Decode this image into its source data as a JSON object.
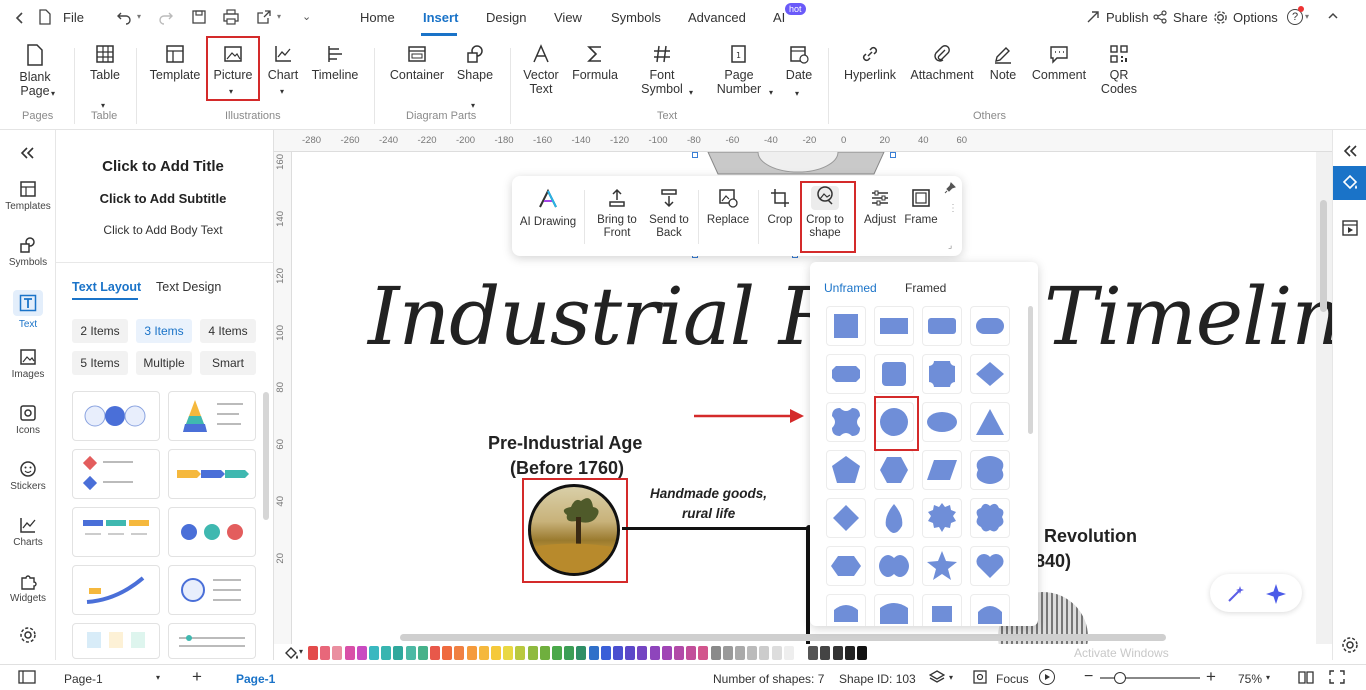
{
  "topbar": {
    "file_label": "File",
    "tabs": [
      "Home",
      "Insert",
      "Design",
      "View",
      "Symbols",
      "Advanced",
      "AI"
    ],
    "active_tab": "Insert",
    "ai_badge": "hot",
    "publish_label": "Publish",
    "share_label": "Share",
    "options_label": "Options"
  },
  "ribbon": {
    "blank_page": "Blank Page",
    "table": "Table",
    "template": "Template",
    "picture": "Picture",
    "chart": "Chart",
    "timeline": "Timeline",
    "container": "Container",
    "shape": "Shape",
    "vector_text": "Vector Text",
    "formula": "Formula",
    "font_symbol": "Font Symbol",
    "page_number": "Page Number",
    "date": "Date",
    "hyperlink": "Hyperlink",
    "attachment": "Attachment",
    "note": "Note",
    "comment": "Comment",
    "qr_codes": "QR Codes",
    "groups": {
      "pages": "Pages",
      "table": "Table",
      "illustrations": "Illustrations",
      "diagram_parts": "Diagram Parts",
      "text": "Text",
      "others": "Others"
    }
  },
  "rail": {
    "items": [
      "Templates",
      "Symbols",
      "Text",
      "Images",
      "Icons",
      "Stickers",
      "Charts",
      "Widgets"
    ],
    "active": "Text"
  },
  "left_panel": {
    "title": "Click to Add Title",
    "subtitle": "Click to Add Subtitle",
    "body": "Click to Add Body Text",
    "tabs": [
      "Text Layout",
      "Text Design"
    ],
    "chips": [
      "2 Items",
      "3 Items",
      "4 Items",
      "5 Items",
      "Multiple",
      "Smart"
    ],
    "active_chip": "3 Items"
  },
  "rulers": {
    "h_ticks": [
      "-280",
      "-260",
      "-240",
      "-220",
      "-200",
      "-180",
      "-160",
      "-140",
      "-120",
      "-100",
      "-80",
      "-60",
      "-40",
      "-20",
      "0",
      "20",
      "40",
      "60"
    ],
    "v_ticks": [
      "160",
      "140",
      "120",
      "100",
      "80",
      "60",
      "40",
      "20"
    ]
  },
  "canvas": {
    "main_title_left": "Industrial Revo",
    "main_title_right": "Timeline",
    "pre_title_1": "Pre-Industrial Age",
    "pre_title_2": "(Before 1760)",
    "handmade_1": "Handmade goods,",
    "handmade_2": "rural life",
    "rev_title_1": "Revolution",
    "rev_title_2": "840)"
  },
  "float_toolbar": {
    "ai_drawing": "AI Drawing",
    "bring_front": "Bring to Front",
    "send_back": "Send to Back",
    "replace": "Replace",
    "crop": "Crop",
    "crop_shape": "Crop to shape",
    "adjust": "Adjust",
    "frame": "Frame"
  },
  "shape_panel": {
    "tabs": [
      "Unframed",
      "Framed"
    ],
    "active_tab": "Unframed",
    "fill_color": "#6f8ed8"
  },
  "status": {
    "page_select": "Page-1",
    "page_tab": "Page-1",
    "shapes_count": "Number of shapes: 7",
    "shape_id": "Shape ID: 103",
    "focus": "Focus",
    "zoom": "75%",
    "watermark": "Activate Windows"
  },
  "colors": {
    "accent": "#1a73c8",
    "highlight": "#d42a2a"
  }
}
